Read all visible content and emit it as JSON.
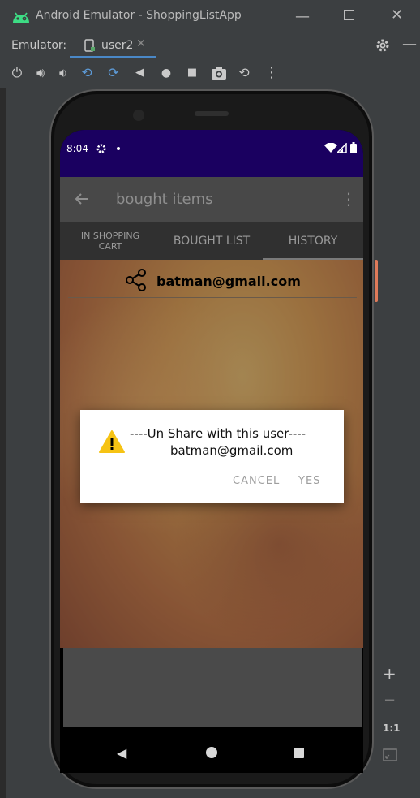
{
  "window": {
    "title": "Android Emulator - ShoppingListApp"
  },
  "emulator_bar": {
    "label": "Emulator:",
    "device_tab": "user2"
  },
  "status": {
    "time": "8:04"
  },
  "appbar": {
    "title": "bought items"
  },
  "tabs": [
    {
      "label": "IN SHOPPING CART"
    },
    {
      "label": "BOUGHT LIST"
    },
    {
      "label": "HISTORY"
    }
  ],
  "share": {
    "email": "batman@gmail.com"
  },
  "dialog": {
    "line1": "----Un Share with this user----",
    "line2": "batman@gmail.com",
    "cancel": "CANCEL",
    "yes": "YES"
  },
  "side_controls": {
    "plus": "+",
    "minus": "−",
    "ratio": "1:1"
  },
  "colors": {
    "status_bar": "#1a0060",
    "accent_line": "#e07b5a",
    "tab_indicator": "#ffffff"
  }
}
